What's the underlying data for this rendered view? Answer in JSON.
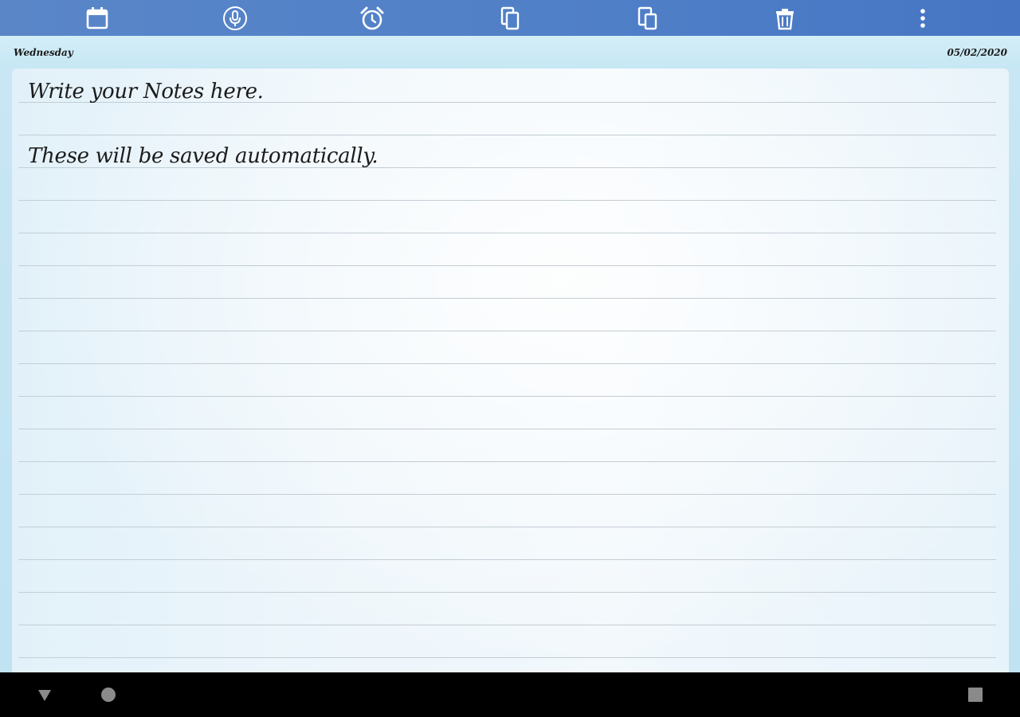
{
  "toolbar": {
    "items": [
      {
        "name": "calendar-icon"
      },
      {
        "name": "microphone-icon"
      },
      {
        "name": "alarm-clock-icon"
      },
      {
        "name": "copy-icon"
      },
      {
        "name": "paste-icon"
      },
      {
        "name": "trash-icon"
      },
      {
        "name": "more-vertical-icon"
      }
    ],
    "color": "#4f7fc7",
    "icon_color": "#ffffff"
  },
  "header": {
    "day": "Wednesday",
    "date": "05/02/2020"
  },
  "note": {
    "lines": [
      "Write your Notes here.",
      "",
      "These will be saved automatically."
    ]
  },
  "navbar": {
    "items": [
      {
        "name": "back-triangle-icon"
      },
      {
        "name": "home-circle-icon"
      },
      {
        "name": "recent-apps-square-icon"
      }
    ]
  }
}
